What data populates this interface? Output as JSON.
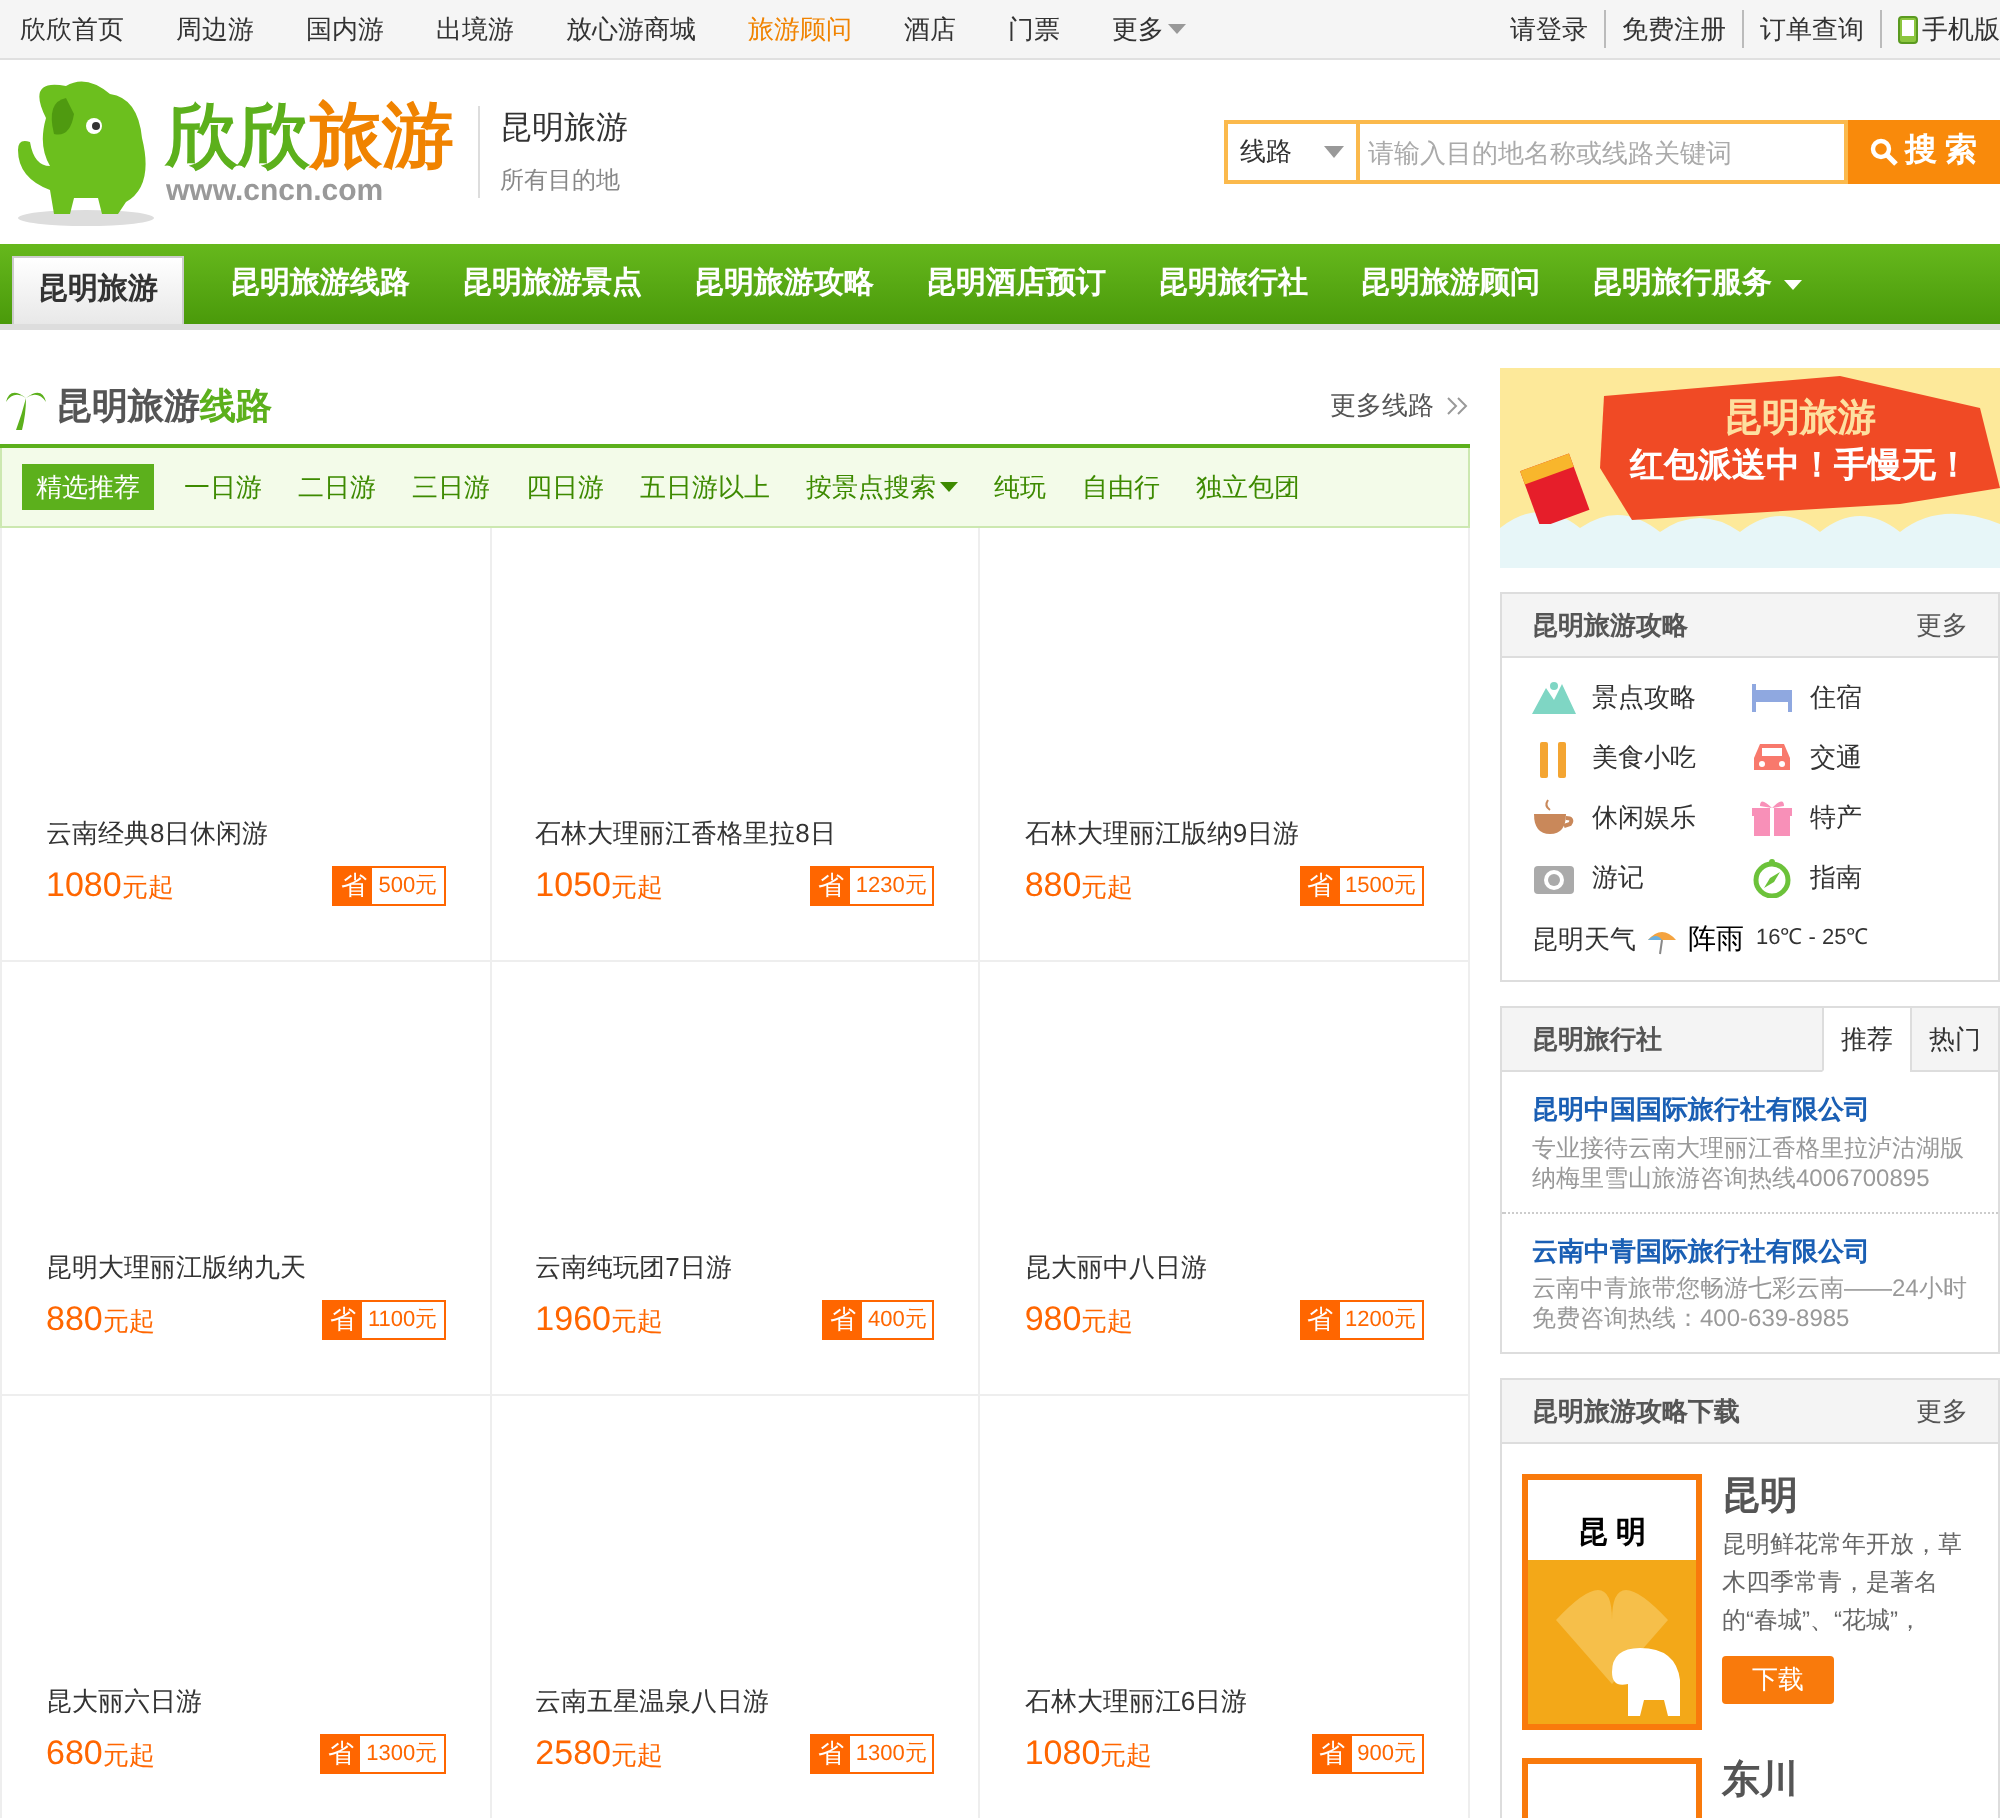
{
  "top_nav": {
    "links": [
      {
        "label": "欣欣首页",
        "selected": false
      },
      {
        "label": "周边游",
        "selected": false
      },
      {
        "label": "国内游",
        "selected": false
      },
      {
        "label": "出境游",
        "selected": false
      },
      {
        "label": "放心游商城",
        "selected": false
      },
      {
        "label": "旅游顾问",
        "selected": true
      },
      {
        "label": "酒店",
        "selected": false
      },
      {
        "label": "门票",
        "selected": false
      }
    ],
    "more": "更多",
    "account": [
      "请登录",
      "免费注册",
      "订单查询"
    ],
    "mobile": "手机版"
  },
  "header": {
    "logo_text": "欣欣",
    "logo_text_2": "旅游",
    "logo_url": "www.cncn.com",
    "city": "昆明旅游",
    "city_sub": "所有目的地",
    "search": {
      "category": "线路",
      "placeholder": "请输入目的地名称或线路关键词",
      "button": "搜 索"
    }
  },
  "main_nav": [
    {
      "label": "昆明旅游",
      "selected": true
    },
    {
      "label": "昆明旅游线路",
      "selected": false
    },
    {
      "label": "昆明旅游景点",
      "selected": false
    },
    {
      "label": "昆明旅游攻略",
      "selected": false
    },
    {
      "label": "昆明酒店预订",
      "selected": false
    },
    {
      "label": "昆明旅行社",
      "selected": false
    },
    {
      "label": "昆明旅游顾问",
      "selected": false
    },
    {
      "label": "昆明旅行服务",
      "selected": false,
      "dropdown": true
    }
  ],
  "routes": {
    "title": "昆明旅游",
    "title_accent": "线路",
    "more": "更多线路",
    "filters": [
      {
        "label": "精选推荐",
        "selected": true
      },
      {
        "label": "一日游",
        "selected": false
      },
      {
        "label": "二日游",
        "selected": false
      },
      {
        "label": "三日游",
        "selected": false
      },
      {
        "label": "四日游",
        "selected": false
      },
      {
        "label": "五日游以上",
        "selected": false
      },
      {
        "label": "按景点搜索",
        "selected": false,
        "dropdown": true
      },
      {
        "label": "纯玩",
        "selected": false
      },
      {
        "label": "自由行",
        "selected": false
      },
      {
        "label": "独立包团",
        "selected": false
      }
    ],
    "items": [
      {
        "name": "云南经典8日休闲游",
        "price": "1080",
        "unit": "元起",
        "save_label": "省",
        "save": "500元"
      },
      {
        "name": "石林大理丽江香格里拉8日",
        "price": "1050",
        "unit": "元起",
        "save_label": "省",
        "save": "1230元"
      },
      {
        "name": "石林大理丽江版纳9日游",
        "price": "880",
        "unit": "元起",
        "save_label": "省",
        "save": "1500元"
      },
      {
        "name": "昆明大理丽江版纳九天",
        "price": "880",
        "unit": "元起",
        "save_label": "省",
        "save": "1100元"
      },
      {
        "name": "云南纯玩团7日游",
        "price": "1960",
        "unit": "元起",
        "save_label": "省",
        "save": "400元"
      },
      {
        "name": "昆大丽中八日游",
        "price": "980",
        "unit": "元起",
        "save_label": "省",
        "save": "1200元"
      },
      {
        "name": "昆大丽六日游",
        "price": "680",
        "unit": "元起",
        "save_label": "省",
        "save": "1300元"
      },
      {
        "name": "云南五星温泉八日游",
        "price": "2580",
        "unit": "元起",
        "save_label": "省",
        "save": "1300元"
      },
      {
        "name": "石林大理丽江6日游",
        "price": "1080",
        "unit": "元起",
        "save_label": "省",
        "save": "900元"
      }
    ]
  },
  "banner": {
    "line_1": "昆明旅游",
    "line_2": "红包派送中！手慢无！"
  },
  "guide": {
    "title": "昆明旅游攻略",
    "more": "更多",
    "items": [
      {
        "label": "景点攻略",
        "kind": "mountain"
      },
      {
        "label": "住宿",
        "kind": "bed"
      },
      {
        "label": "美食小吃",
        "kind": "fork"
      },
      {
        "label": "交通",
        "kind": "car"
      },
      {
        "label": "休闲娱乐",
        "kind": "cup"
      },
      {
        "label": "特产",
        "kind": "gift"
      },
      {
        "label": "游记",
        "kind": "camera"
      },
      {
        "label": "指南",
        "kind": "compass"
      }
    ],
    "weather": {
      "label": "昆明天气",
      "condition": "阵雨",
      "range": "16℃ - 25℃"
    }
  },
  "agencies": {
    "title": "昆明旅行社",
    "tabs": [
      {
        "label": "推荐",
        "selected": true
      },
      {
        "label": "热门",
        "selected": false
      }
    ],
    "items": [
      {
        "name": "昆明中国国际旅行社有限公司",
        "desc": "专业接待云南大理丽江香格里拉泸沽湖版纳梅里雪山旅游咨询热线4006700895"
      },
      {
        "name": "云南中青国际旅行社有限公司",
        "desc": "云南中青旅带您畅游七彩云南——24小时免费咨询热线：400-639-8985"
      }
    ]
  },
  "downloads": {
    "title": "昆明旅游攻略下载",
    "more": "更多",
    "items": [
      {
        "name": "昆明",
        "cover": "昆 明",
        "desc": "昆明鲜花常年开放，草木四季常青，是著名的“春城”、“花城”，",
        "button": "下载"
      },
      {
        "name": "东川"
      }
    ]
  }
}
